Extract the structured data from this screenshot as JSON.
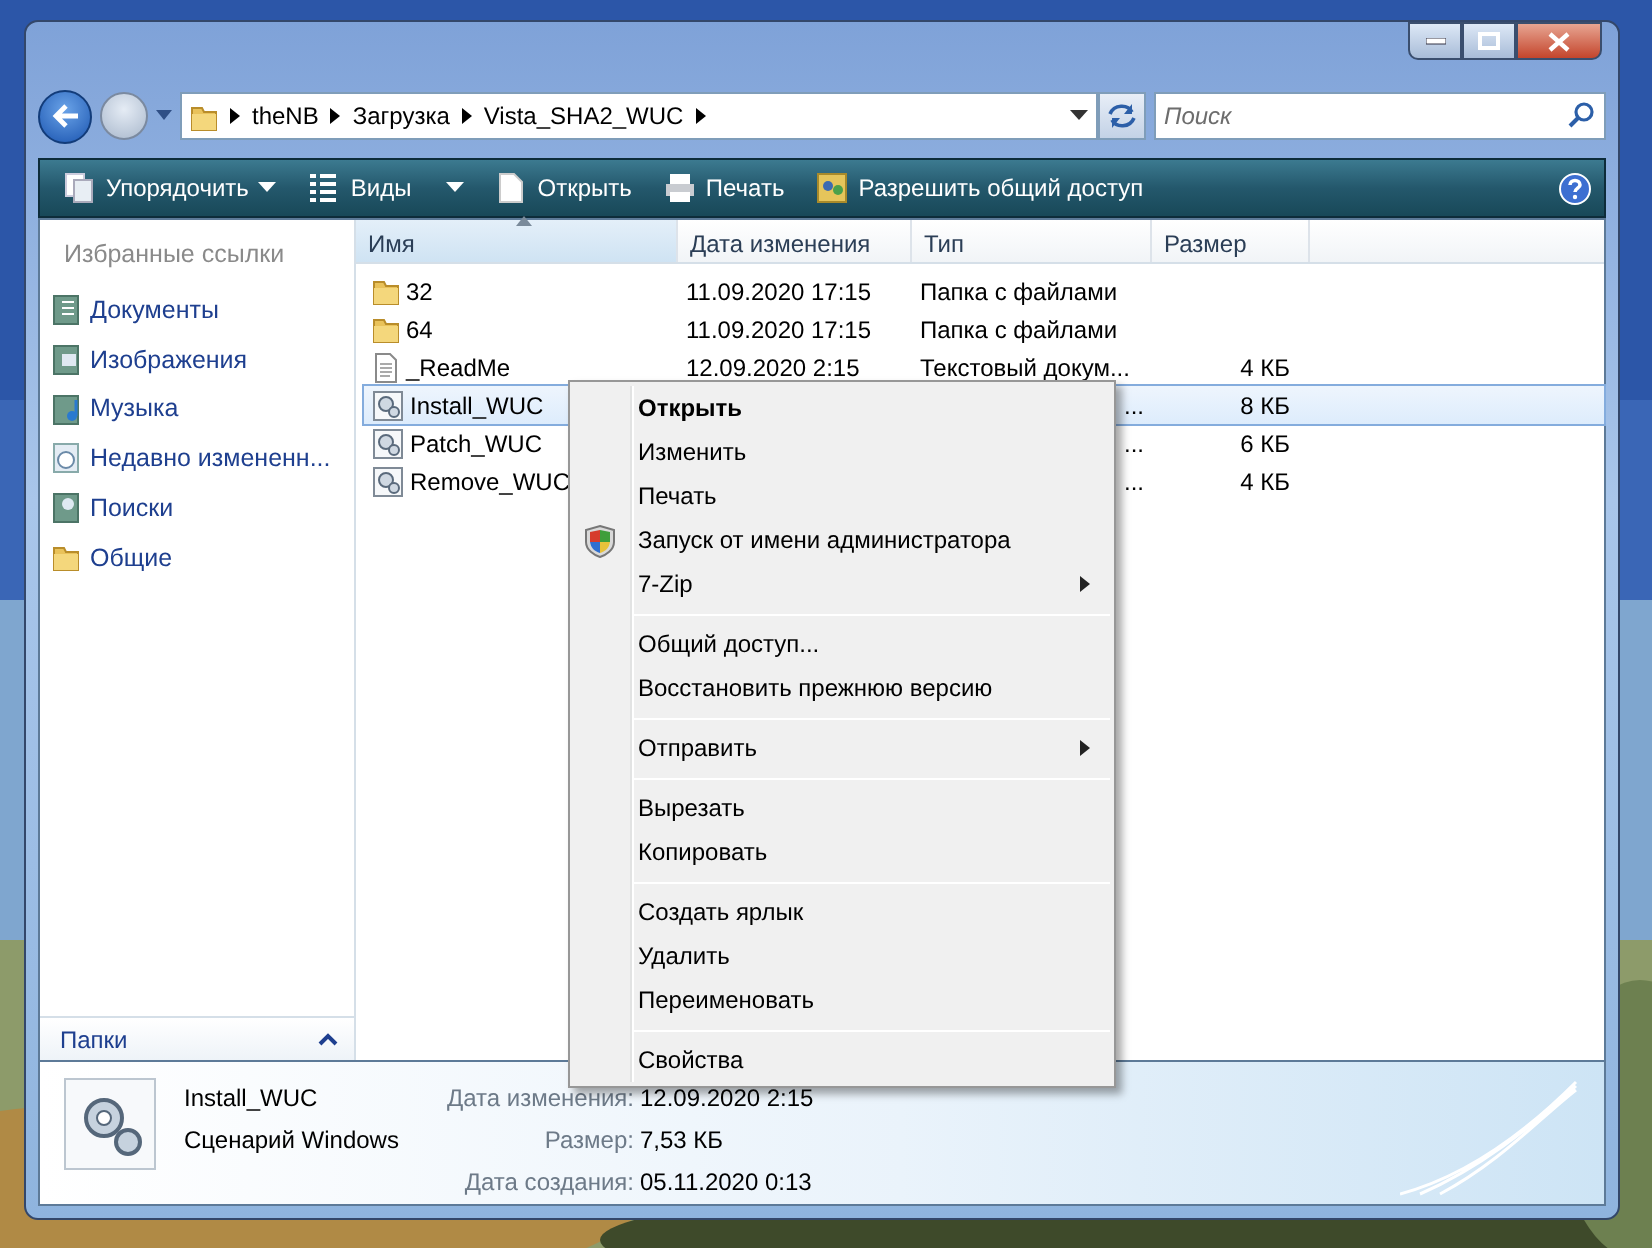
{
  "address": {
    "path": [
      "theNB",
      "Загрузка",
      "Vista_SHA2_WUC"
    ]
  },
  "search": {
    "placeholder": "Поиск"
  },
  "toolbar": [
    {
      "label": "Упорядочить",
      "kind": "organize"
    },
    {
      "label": "Виды",
      "kind": "views"
    },
    {
      "label": "Открыть",
      "kind": "open"
    },
    {
      "label": "Печать",
      "kind": "print"
    },
    {
      "label": "Разрешить общий доступ",
      "kind": "share"
    }
  ],
  "sidebar": {
    "title": "Избранные ссылки",
    "items": [
      {
        "label": "Документы",
        "kind": "docs"
      },
      {
        "label": "Изображения",
        "kind": "pictures"
      },
      {
        "label": "Музыка",
        "kind": "music"
      },
      {
        "label": "Недавно измененн...",
        "kind": "recent"
      },
      {
        "label": "Поиски",
        "kind": "searches"
      },
      {
        "label": "Общие",
        "kind": "folder"
      }
    ],
    "footer": "Папки"
  },
  "table": {
    "columns": [
      {
        "label": "Имя",
        "sorted": true
      },
      {
        "label": "Дата изменения",
        "sorted": false
      },
      {
        "label": "Тип",
        "sorted": false
      },
      {
        "label": "Размер",
        "sorted": false
      }
    ],
    "rows": [
      {
        "name": "32",
        "kind": "folder",
        "date": "11.09.2020 17:15",
        "type": "Папка с файлами",
        "selected": false
      },
      {
        "name": "64",
        "kind": "folder",
        "date": "11.09.2020 17:15",
        "type": "Папка с файлами",
        "selected": false
      },
      {
        "name": "_ReadMe",
        "kind": "text",
        "date": "12.09.2020 2:15",
        "type": "Текстовый докум...",
        "size": "4 КБ",
        "selected": false
      },
      {
        "name": "Install_WUC",
        "kind": "script",
        "type": "...",
        "size": "8 КБ",
        "selected": true
      },
      {
        "name": "Patch_WUC",
        "kind": "script",
        "type": "...",
        "size": "6 КБ",
        "selected": false
      },
      {
        "name": "Remove_WUC",
        "kind": "script",
        "type": "...",
        "size": "4 КБ",
        "selected": false
      }
    ]
  },
  "context_menu": [
    {
      "label": "Открыть",
      "kind": "default"
    },
    {
      "label": "Изменить",
      "kind": "item"
    },
    {
      "label": "Печать",
      "kind": "item"
    },
    {
      "label": "Запуск от имени администратора",
      "kind": "admin"
    },
    {
      "label": "7-Zip",
      "kind": "submenu"
    },
    {
      "kind": "separator"
    },
    {
      "label": "Общий доступ...",
      "kind": "item"
    },
    {
      "label": "Восстановить прежнюю версию",
      "kind": "item"
    },
    {
      "kind": "separator"
    },
    {
      "label": "Отправить",
      "kind": "submenu"
    },
    {
      "kind": "separator"
    },
    {
      "label": "Вырезать",
      "kind": "item"
    },
    {
      "label": "Копировать",
      "kind": "item"
    },
    {
      "kind": "separator"
    },
    {
      "label": "Создать ярлык",
      "kind": "item"
    },
    {
      "label": "Удалить",
      "kind": "item"
    },
    {
      "label": "Переименовать",
      "kind": "item"
    },
    {
      "kind": "separator"
    },
    {
      "label": "Свойства",
      "kind": "item"
    }
  ],
  "details": {
    "name": "Install_WUC",
    "type": "Сценарий Windows",
    "fields": [
      {
        "label": "Дата изменения:",
        "value": "12.09.2020 2:15"
      },
      {
        "label": "Размер:",
        "value": "7,53 КБ"
      },
      {
        "label": "Дата создания:",
        "value": "05.11.2020 0:13"
      }
    ]
  }
}
